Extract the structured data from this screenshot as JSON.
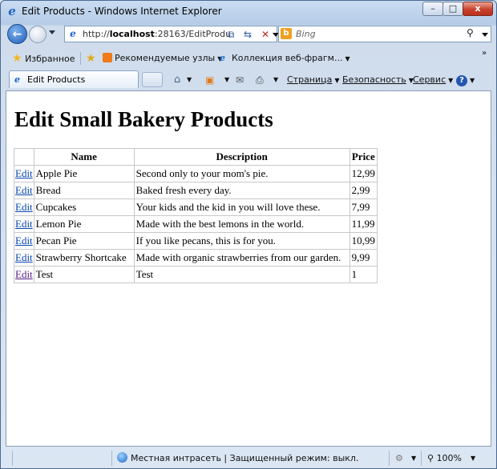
{
  "window": {
    "title": "Edit Products - Windows Internet Explorer",
    "controls": {
      "minimize": "–",
      "maximize": "□",
      "close": "x"
    }
  },
  "nav": {
    "address_prefix": "http://",
    "address_host": "localhost",
    "address_rest": ":28163/EditProdu",
    "search_placeholder": "Bing"
  },
  "favorites": {
    "label": "Избранное",
    "items": [
      "Рекомендуемые узлы",
      "Коллекция веб-фрагм..."
    ]
  },
  "tab": {
    "label": "Edit Products"
  },
  "commands": {
    "page": "Страница",
    "safety": "Безопасность",
    "tools": "Сервис"
  },
  "page": {
    "heading": "Edit Small Bakery Products",
    "columns": [
      "Name",
      "Description",
      "Price"
    ],
    "edit_label": "Edit",
    "rows": [
      {
        "name": "Apple Pie",
        "description": "Second only to your mom's pie.",
        "price": "12,99"
      },
      {
        "name": "Bread",
        "description": "Baked fresh every day.",
        "price": "2,99"
      },
      {
        "name": "Cupcakes",
        "description": "Your kids and the kid in you will love these.",
        "price": "7,99"
      },
      {
        "name": "Lemon Pie",
        "description": "Made with the best lemons in the world.",
        "price": "11,99"
      },
      {
        "name": "Pecan Pie",
        "description": "If you like pecans, this is for you.",
        "price": "10,99"
      },
      {
        "name": "Strawberry Shortcake",
        "description": "Made with organic strawberries from our garden.",
        "price": "9,99"
      },
      {
        "name": "Test",
        "description": "Test",
        "price": "1"
      }
    ]
  },
  "status": {
    "zone": "Местная интрасеть | Защищенный режим: выкл.",
    "zoom": "100%"
  }
}
